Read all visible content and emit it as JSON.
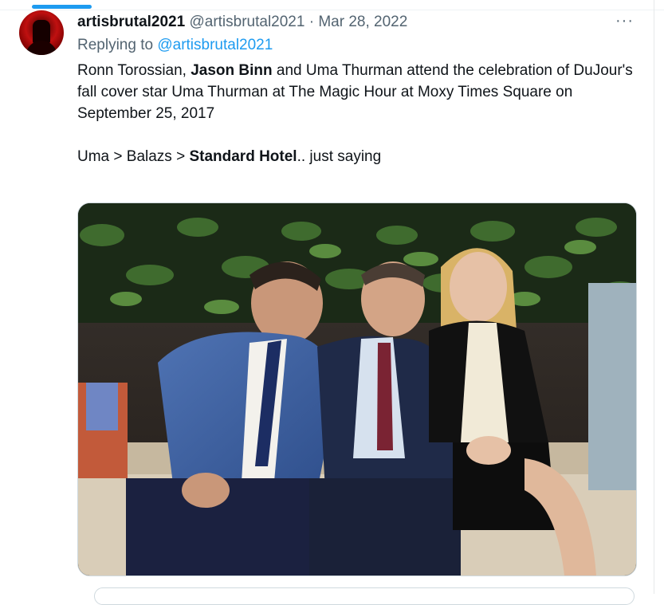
{
  "tweet": {
    "display_name": "artisbrutal2021",
    "handle": "@artisbrutal2021",
    "separator": "·",
    "date": "Mar 28, 2022",
    "more_icon": "···",
    "replying_prefix": "Replying to",
    "replying_mention": "@artisbrutal2021",
    "para1": {
      "a": "Ronn Torossian, ",
      "b": "Jason Binn",
      "c": " and Uma Thurman attend the celebration of DuJour's fall cover star Uma Thurman at The Magic Hour at Moxy Times Square on September 25, 2017"
    },
    "para2": {
      "a": "Uma > Balazs > ",
      "b": "Standard Hotel",
      "c": ".. just saying"
    }
  },
  "colors": {
    "accent": "#1d9bf0",
    "secondary_text": "#536471",
    "primary_text": "#0f1419"
  }
}
